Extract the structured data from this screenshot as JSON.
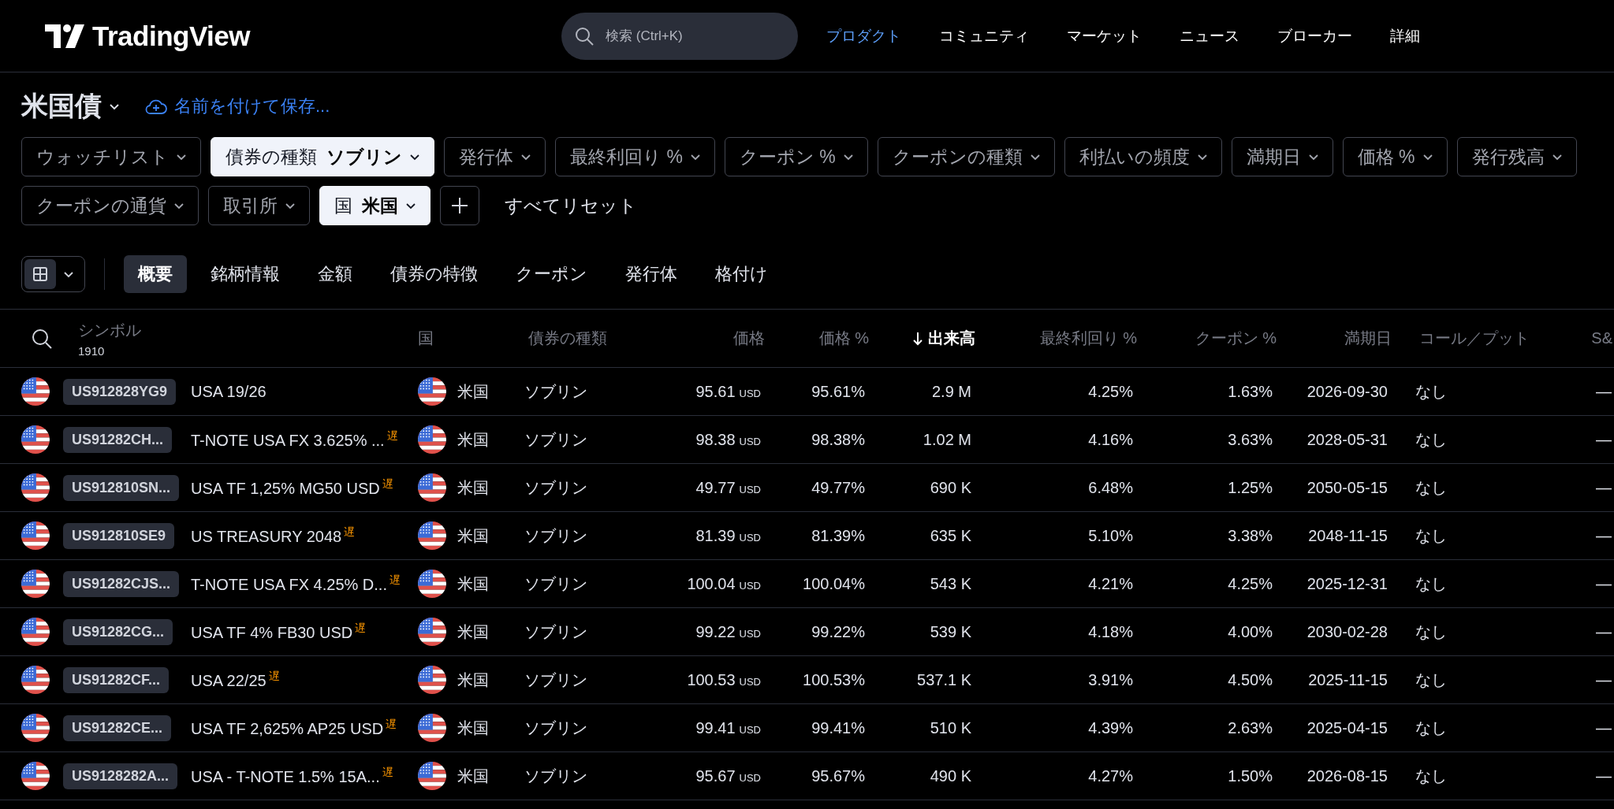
{
  "header": {
    "logo": "TradingView",
    "search": {
      "placeholder": "検索 (Ctrl+K)"
    },
    "nav": [
      {
        "label": "プロダクト",
        "selected": true
      },
      {
        "label": "コミュニティ",
        "selected": false
      },
      {
        "label": "マーケット",
        "selected": false
      },
      {
        "label": "ニュース",
        "selected": false
      },
      {
        "label": "ブローカー",
        "selected": false
      },
      {
        "label": "詳細",
        "selected": false
      }
    ]
  },
  "screen": {
    "title": "米国債",
    "save_link": "名前を付けて保存..."
  },
  "filters": {
    "chips": [
      {
        "label": "ウォッチリスト",
        "selected": false
      },
      {
        "label": "債券の種類",
        "value": "ソブリン",
        "selected": true
      },
      {
        "label": "発行体",
        "selected": false
      },
      {
        "label": "最終利回り %",
        "selected": false
      },
      {
        "label": "クーポン %",
        "selected": false
      },
      {
        "label": "クーポンの種類",
        "selected": false
      },
      {
        "label": "利払いの頻度",
        "selected": false
      },
      {
        "label": "満期日",
        "selected": false
      },
      {
        "label": "価格 %",
        "selected": false
      },
      {
        "label": "発行残高",
        "selected": false
      },
      {
        "label": "クーポンの通貨",
        "selected": false
      },
      {
        "label": "取引所",
        "selected": false
      },
      {
        "label": "国",
        "value": "米国",
        "selected": true
      }
    ],
    "reset": "すべてリセット"
  },
  "view_toggle": {
    "grid_selected": true
  },
  "tabs": [
    {
      "label": "概要",
      "selected": true
    },
    {
      "label": "銘柄情報",
      "selected": false
    },
    {
      "label": "金額",
      "selected": false
    },
    {
      "label": "債券の特徴",
      "selected": false
    },
    {
      "label": "クーポン",
      "selected": false
    },
    {
      "label": "発行体",
      "selected": false
    },
    {
      "label": "格付け",
      "selected": false
    }
  ],
  "table": {
    "columns": [
      {
        "label": "シンボル",
        "count": "1910",
        "sorted": false
      },
      {
        "label": "国",
        "sorted": false
      },
      {
        "label": "債券の種類",
        "sorted": false
      },
      {
        "label": "価格",
        "sorted": false
      },
      {
        "label": "価格 %",
        "sorted": false
      },
      {
        "label": "出来高",
        "sorted": true
      },
      {
        "label": "最終利回り %",
        "sorted": false
      },
      {
        "label": "クーポン %",
        "sorted": false
      },
      {
        "label": "満期日",
        "sorted": false
      },
      {
        "label": "コール／プット",
        "sorted": false
      },
      {
        "label": "S&",
        "sorted": false
      }
    ],
    "rows": [
      {
        "symbol": "US912828YG9",
        "name": "USA 19/26",
        "country": "米国",
        "bond_type": "ソブリン",
        "price": "95.61",
        "currency": "USD",
        "price_pct": "95.61%",
        "volume": "2.9 M",
        "yield": "4.25%",
        "coupon": "1.63%",
        "maturity": "2026-09-30",
        "call_put": "なし",
        "column_12": "—"
      },
      {
        "symbol": "US91282CH...",
        "name": "T-NOTE USA FX 3.625% ...$^{遅}$",
        "country": "米国",
        "bond_type": "ソブリン",
        "price": "98.38",
        "currency": "USD",
        "price_pct": "98.38%",
        "volume": "1.02 M",
        "yield": "4.16%",
        "coupon": "3.63%",
        "maturity": "2028-05-31",
        "call_put": "なし",
        "column_12": "—"
      },
      {
        "symbol": "US912810SN...",
        "name": "USA TF 1,25% MG50 USD$^{遅}$",
        "country": "米国",
        "bond_type": "ソブリン",
        "price": "49.77",
        "currency": "USD",
        "price_pct": "49.77%",
        "volume": "690 K",
        "yield": "6.48%",
        "coupon": "1.25%",
        "maturity": "2050-05-15",
        "call_put": "なし",
        "column_12": "—"
      },
      {
        "symbol": "US912810SE9",
        "name": "US TREASURY 2048$^{遅}$",
        "country": "米国",
        "bond_type": "ソブリン",
        "price": "81.39",
        "currency": "USD",
        "price_pct": "81.39%",
        "volume": "635 K",
        "yield": "5.10%",
        "coupon": "3.38%",
        "maturity": "2048-11-15",
        "call_put": "なし",
        "column_12": "—"
      },
      {
        "symbol": "US91282CJS...",
        "name": "T-NOTE USA FX 4.25% D...$^{遅}$",
        "country": "米国",
        "bond_type": "ソブリン",
        "price": "100.04",
        "currency": "USD",
        "price_pct": "100.04%",
        "volume": "543 K",
        "yield": "4.21%",
        "coupon": "4.25%",
        "maturity": "2025-12-31",
        "call_put": "なし",
        "column_12": "—"
      },
      {
        "symbol": "US91282CG...",
        "name": "USA TF 4% FB30 USD$^{遅}$",
        "country": "米国",
        "bond_type": "ソブリン",
        "price": "99.22",
        "currency": "USD",
        "price_pct": "99.22%",
        "volume": "539 K",
        "yield": "4.18%",
        "coupon": "4.00%",
        "maturity": "2030-02-28",
        "call_put": "なし",
        "column_12": "—"
      },
      {
        "symbol": "US91282CF...",
        "name": "USA 22/25$^{遅}$",
        "country": "米国",
        "bond_type": "ソブリン",
        "price": "100.53",
        "currency": "USD",
        "price_pct": "100.53%",
        "volume": "537.1 K",
        "yield": "3.91%",
        "coupon": "4.50%",
        "maturity": "2025-11-15",
        "call_put": "なし",
        "column_12": "—"
      },
      {
        "symbol": "US91282CE...",
        "name": "USA TF 2,625% AP25 USD$^{遅}$",
        "country": "米国",
        "bond_type": "ソブリン",
        "price": "99.41",
        "currency": "USD",
        "price_pct": "99.41%",
        "volume": "510 K",
        "yield": "4.39%",
        "coupon": "2.63%",
        "maturity": "2025-04-15",
        "call_put": "なし",
        "column_12": "—"
      },
      {
        "symbol": "US9128282A...",
        "name": "USA - T-NOTE 1.5% 15A...$^{遅}$",
        "country": "米国",
        "bond_type": "ソブリン",
        "price": "95.67",
        "currency": "USD",
        "price_pct": "95.67%",
        "volume": "490 K",
        "yield": "4.27%",
        "coupon": "1.50%",
        "maturity": "2026-08-15",
        "call_put": "なし",
        "column_12": "—"
      }
    ]
  }
}
